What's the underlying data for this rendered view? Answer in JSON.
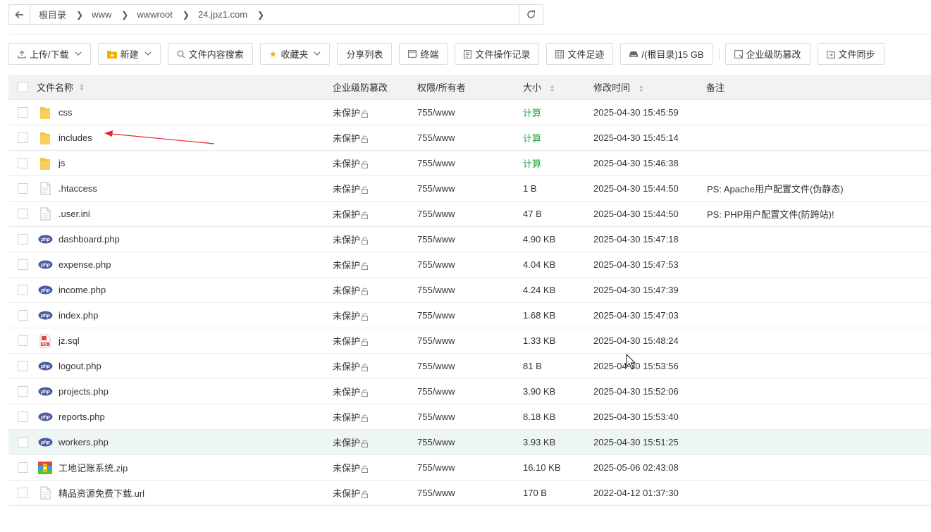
{
  "path": {
    "crumbs": [
      "根目录",
      "www",
      "wwwroot",
      "24.jpz1.com"
    ]
  },
  "toolbar": {
    "upload": "上传/下载",
    "new": "新建",
    "search_content": "文件内容搜索",
    "favorites": "收藏夹",
    "share_list": "分享列表",
    "terminal": "终端",
    "op_log": "文件操作记录",
    "footprint": "文件足迹",
    "disk": "/(根目录)15 GB",
    "tamper": "企业级防篡改",
    "sync": "文件同步"
  },
  "table": {
    "headers": {
      "name": "文件名称",
      "protect": "企业级防篡改",
      "perm": "权限/所有者",
      "size": "大小",
      "mtime": "修改时间",
      "note": "备注"
    },
    "rows": [
      {
        "name": "css",
        "icon": "folder-icon",
        "protect": "未保护",
        "perm": "755/www",
        "size": "计算",
        "mtime": "2025-04-30 15:45:59",
        "note": ""
      },
      {
        "name": "includes",
        "icon": "folder-icon",
        "protect": "未保护",
        "perm": "755/www",
        "size": "计算",
        "mtime": "2025-04-30 15:45:14",
        "note": ""
      },
      {
        "name": "js",
        "icon": "folder-icon",
        "protect": "未保护",
        "perm": "755/www",
        "size": "计算",
        "mtime": "2025-04-30 15:46:38",
        "note": ""
      },
      {
        "name": ".htaccess",
        "icon": "file-icon",
        "protect": "未保护",
        "perm": "755/www",
        "size": "1 B",
        "mtime": "2025-04-30 15:44:50",
        "note": "PS: Apache用户配置文件(伪静态)"
      },
      {
        "name": ".user.ini",
        "icon": "file-icon",
        "protect": "未保护",
        "perm": "755/www",
        "size": "47 B",
        "mtime": "2025-04-30 15:44:50",
        "note": "PS: PHP用户配置文件(防跨站)!"
      },
      {
        "name": "dashboard.php",
        "icon": "php-icon",
        "protect": "未保护",
        "perm": "755/www",
        "size": "4.90 KB",
        "mtime": "2025-04-30 15:47:18",
        "note": ""
      },
      {
        "name": "expense.php",
        "icon": "php-icon",
        "protect": "未保护",
        "perm": "755/www",
        "size": "4.04 KB",
        "mtime": "2025-04-30 15:47:53",
        "note": ""
      },
      {
        "name": "income.php",
        "icon": "php-icon",
        "protect": "未保护",
        "perm": "755/www",
        "size": "4.24 KB",
        "mtime": "2025-04-30 15:47:39",
        "note": ""
      },
      {
        "name": "index.php",
        "icon": "php-icon",
        "protect": "未保护",
        "perm": "755/www",
        "size": "1.68 KB",
        "mtime": "2025-04-30 15:47:03",
        "note": ""
      },
      {
        "name": "jz.sql",
        "icon": "sql-icon",
        "protect": "未保护",
        "perm": "755/www",
        "size": "1.33 KB",
        "mtime": "2025-04-30 15:48:24",
        "note": ""
      },
      {
        "name": "logout.php",
        "icon": "php-icon",
        "protect": "未保护",
        "perm": "755/www",
        "size": "81 B",
        "mtime": "2025-04-30 15:53:56",
        "note": ""
      },
      {
        "name": "projects.php",
        "icon": "php-icon",
        "protect": "未保护",
        "perm": "755/www",
        "size": "3.90 KB",
        "mtime": "2025-04-30 15:52:06",
        "note": ""
      },
      {
        "name": "reports.php",
        "icon": "php-icon",
        "protect": "未保护",
        "perm": "755/www",
        "size": "8.18 KB",
        "mtime": "2025-04-30 15:53:40",
        "note": ""
      },
      {
        "name": "workers.php",
        "icon": "php-icon",
        "protect": "未保护",
        "perm": "755/www",
        "size": "3.93 KB",
        "mtime": "2025-04-30 15:51:25",
        "note": ""
      },
      {
        "name": "工地记账系统.zip",
        "icon": "zip-icon",
        "protect": "未保护",
        "perm": "755/www",
        "size": "16.10 KB",
        "mtime": "2025-05-06 02:43:08",
        "note": ""
      },
      {
        "name": "精品资源免费下载.url",
        "icon": "file-icon",
        "protect": "未保护",
        "perm": "755/www",
        "size": "170 B",
        "mtime": "2022-04-12 01:37:30",
        "note": ""
      }
    ]
  },
  "colors": {
    "calc_green": "#20a53a",
    "highlight_row": "#eef6f3",
    "folder": "#f5c342",
    "php_badge": "#4a5a9c",
    "annotation_arrow": "#e8242a"
  }
}
